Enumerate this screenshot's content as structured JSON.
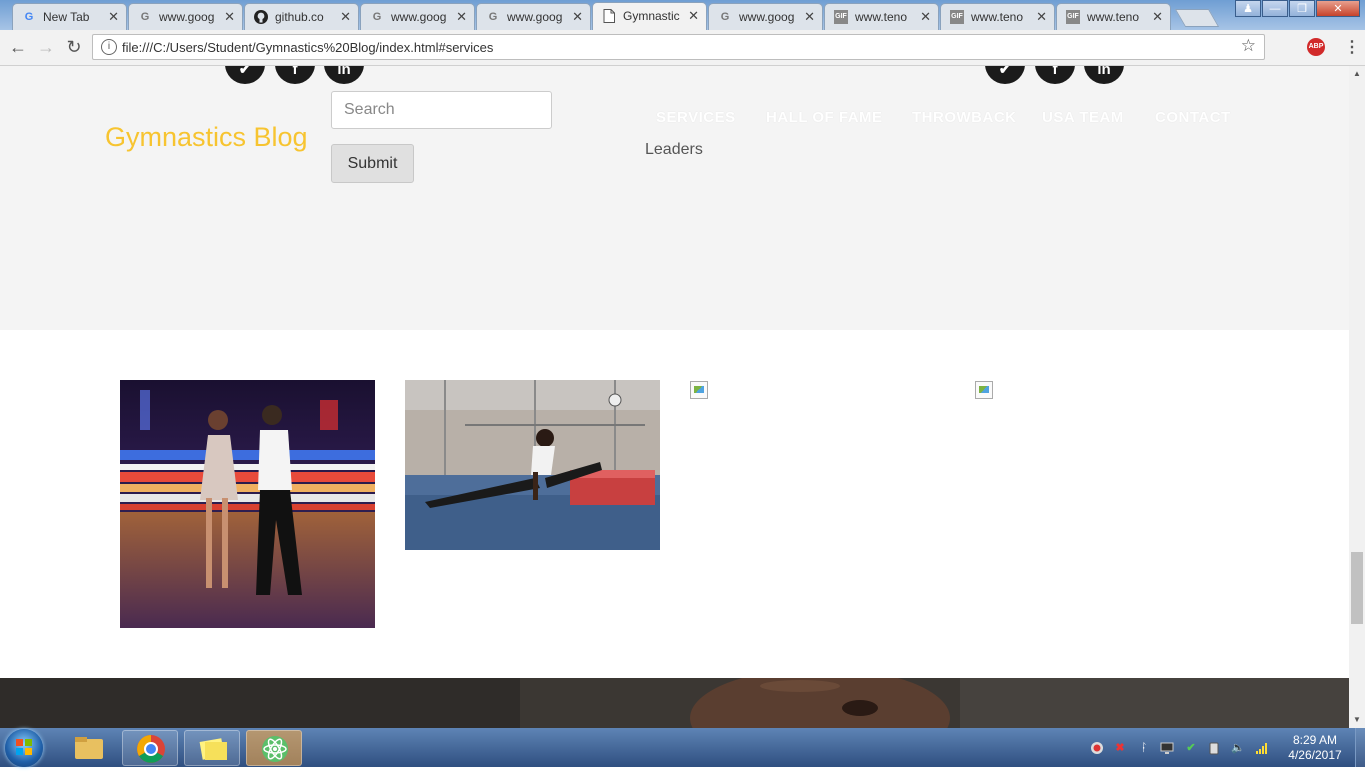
{
  "browser": {
    "tabs": [
      {
        "favicon": "G",
        "label": "New Tab"
      },
      {
        "favicon": "G",
        "label": "www.goog"
      },
      {
        "favicon": "github-icon",
        "label": "github.co"
      },
      {
        "favicon": "G",
        "label": "www.goog"
      },
      {
        "favicon": "G",
        "label": "www.goog"
      },
      {
        "favicon": "page-icon",
        "label": "Gymnastic"
      },
      {
        "favicon": "G",
        "label": "www.goog"
      },
      {
        "favicon": "GIF",
        "label": "www.teno"
      },
      {
        "favicon": "GIF",
        "label": "www.teno"
      },
      {
        "favicon": "GIF",
        "label": "www.teno"
      }
    ],
    "active_tab_index": 5,
    "close_glyph": "✕",
    "url": "file:///C:/Users/Student/Gymnastics%20Blog/index.html#services",
    "abp_label": "ABP"
  },
  "page": {
    "brand": "Gymnastics Blog",
    "search": {
      "placeholder": "Search",
      "value": ""
    },
    "submit_label": "Submit",
    "nav": [
      "SERVICES",
      "HALL OF FAME",
      "THROWBACK",
      "USA TEAM",
      "CONTACT"
    ],
    "leaders_label": "Leaders",
    "social_icons": [
      "twitter-icon",
      "facebook-icon",
      "linkedin-icon",
      "twitter-icon",
      "facebook-icon",
      "linkedin-icon"
    ],
    "social_glyphs": [
      "✔",
      "f",
      "in",
      "✔",
      "f",
      "in"
    ]
  },
  "taskbar": {
    "apps": [
      "chrome",
      "file-explorer",
      "sticky-notes",
      "atom"
    ],
    "clock_time": "8:29 AM",
    "clock_date": "4/26/2017"
  },
  "colors": {
    "brand": "#f7c430",
    "hero_bg": "#f4f4f4",
    "taskbar": "#2f4f80"
  }
}
